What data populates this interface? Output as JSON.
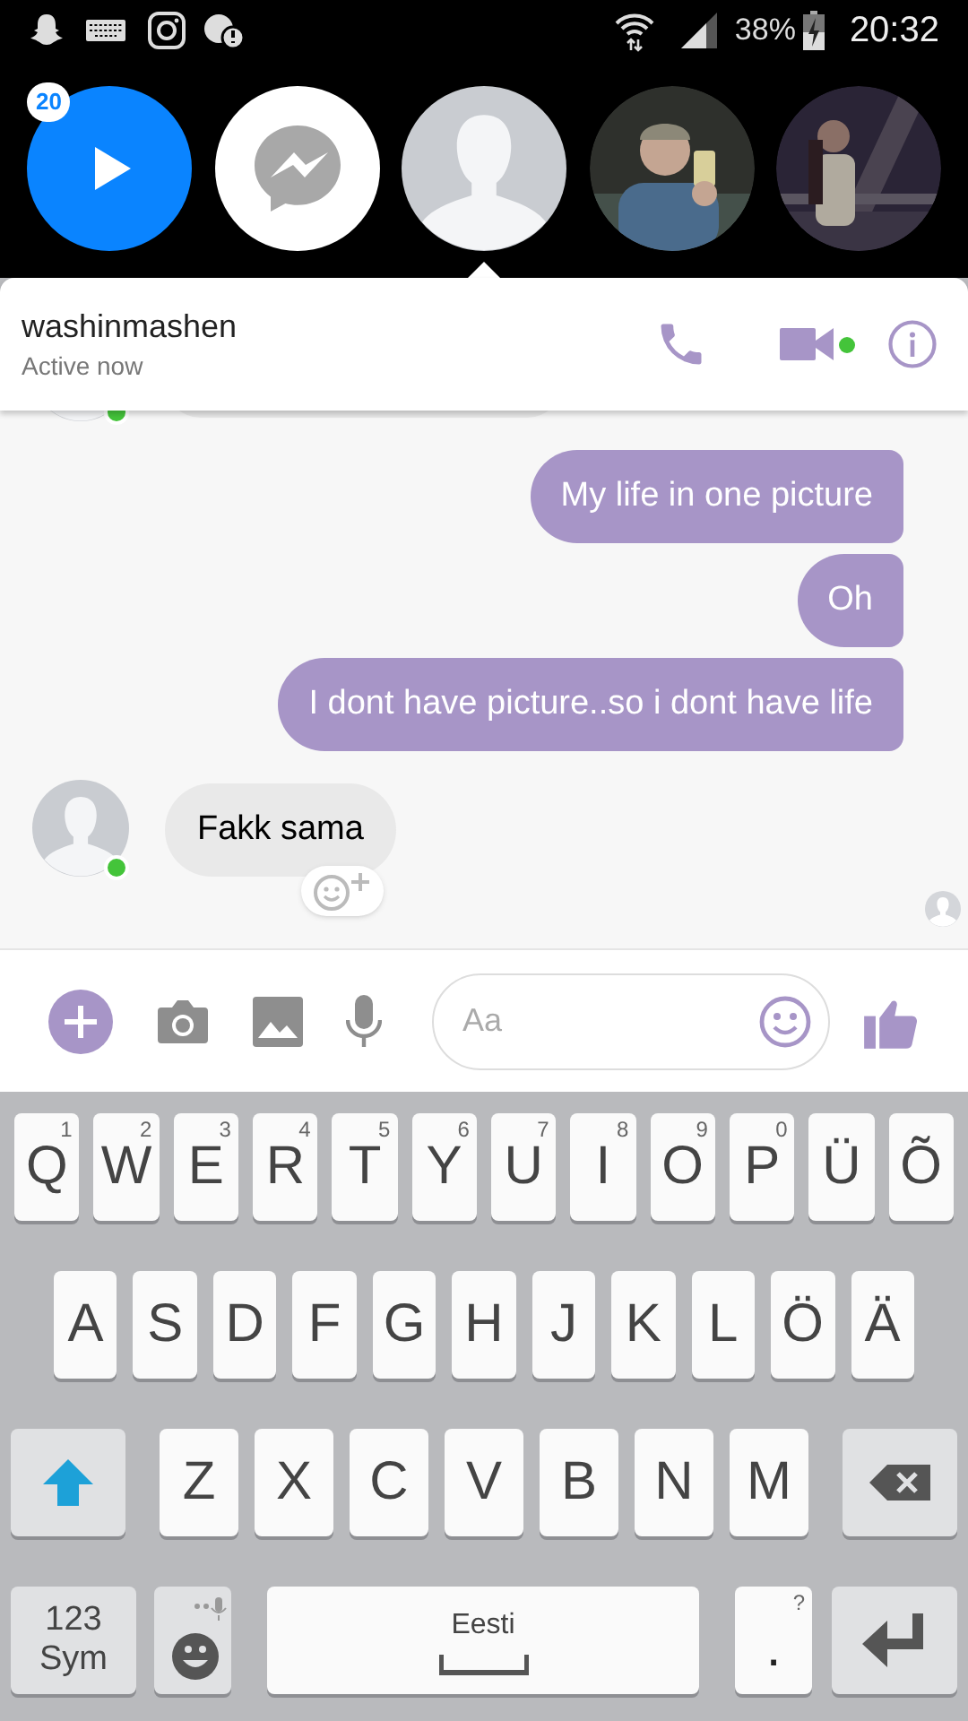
{
  "status_bar": {
    "battery": "38%",
    "time": "20:32"
  },
  "chat_heads": [
    {
      "kind": "play",
      "badge": "20",
      "selected": false
    },
    {
      "kind": "messenger",
      "selected": false
    },
    {
      "kind": "avatar",
      "selected": true
    },
    {
      "kind": "picture",
      "selected": false
    },
    {
      "kind": "picture",
      "selected": false
    }
  ],
  "header": {
    "name": "washinmashen",
    "status": "Active now",
    "video_online": true
  },
  "messages": [
    {
      "kind": "received_cut",
      "online": true
    },
    {
      "kind": "sent",
      "text": "My life in one picture"
    },
    {
      "kind": "sent",
      "text": "Oh"
    },
    {
      "kind": "sent",
      "text": "I dont have picture..so i dont have life"
    },
    {
      "kind": "received",
      "text": "Fakk sama",
      "online": true,
      "reaction": true
    }
  ],
  "composer": {
    "placeholder": "Aa"
  },
  "keyboard": {
    "rows": [
      [
        {
          "kind": "letter",
          "label": "Q",
          "hint": "1"
        },
        {
          "kind": "letter",
          "label": "W",
          "hint": "2"
        },
        {
          "kind": "letter",
          "label": "E",
          "hint": "3"
        },
        {
          "kind": "letter",
          "label": "R",
          "hint": "4"
        },
        {
          "kind": "letter",
          "label": "T",
          "hint": "5"
        },
        {
          "kind": "letter",
          "label": "Y",
          "hint": "6"
        },
        {
          "kind": "letter",
          "label": "U",
          "hint": "7"
        },
        {
          "kind": "letter",
          "label": "I",
          "hint": "8"
        },
        {
          "kind": "letter",
          "label": "O",
          "hint": "9"
        },
        {
          "kind": "letter",
          "label": "P",
          "hint": "0"
        },
        {
          "kind": "letter",
          "label": "Ü"
        },
        {
          "kind": "letter",
          "label": "Õ"
        }
      ],
      [
        {
          "kind": "letter",
          "label": "A"
        },
        {
          "kind": "letter",
          "label": "S"
        },
        {
          "kind": "letter",
          "label": "D"
        },
        {
          "kind": "letter",
          "label": "F"
        },
        {
          "kind": "letter",
          "label": "G"
        },
        {
          "kind": "letter",
          "label": "H"
        },
        {
          "kind": "letter",
          "label": "J"
        },
        {
          "kind": "letter",
          "label": "K"
        },
        {
          "kind": "letter",
          "label": "L"
        },
        {
          "kind": "letter",
          "label": "Ö"
        },
        {
          "kind": "letter",
          "label": "Ä"
        }
      ],
      [
        {
          "kind": "shift"
        },
        {
          "kind": "letter",
          "label": "Z"
        },
        {
          "kind": "letter",
          "label": "X"
        },
        {
          "kind": "letter",
          "label": "C"
        },
        {
          "kind": "letter",
          "label": "V"
        },
        {
          "kind": "letter",
          "label": "B"
        },
        {
          "kind": "letter",
          "label": "N"
        },
        {
          "kind": "letter",
          "label": "M"
        },
        {
          "kind": "backspace"
        }
      ],
      [
        {
          "kind": "sym",
          "label": "123",
          "label2": "Sym"
        },
        {
          "kind": "emoji"
        },
        {
          "kind": "space",
          "label": "Eesti"
        },
        {
          "kind": "period",
          "label": ".",
          "hint": "?"
        },
        {
          "kind": "enter"
        }
      ]
    ]
  }
}
